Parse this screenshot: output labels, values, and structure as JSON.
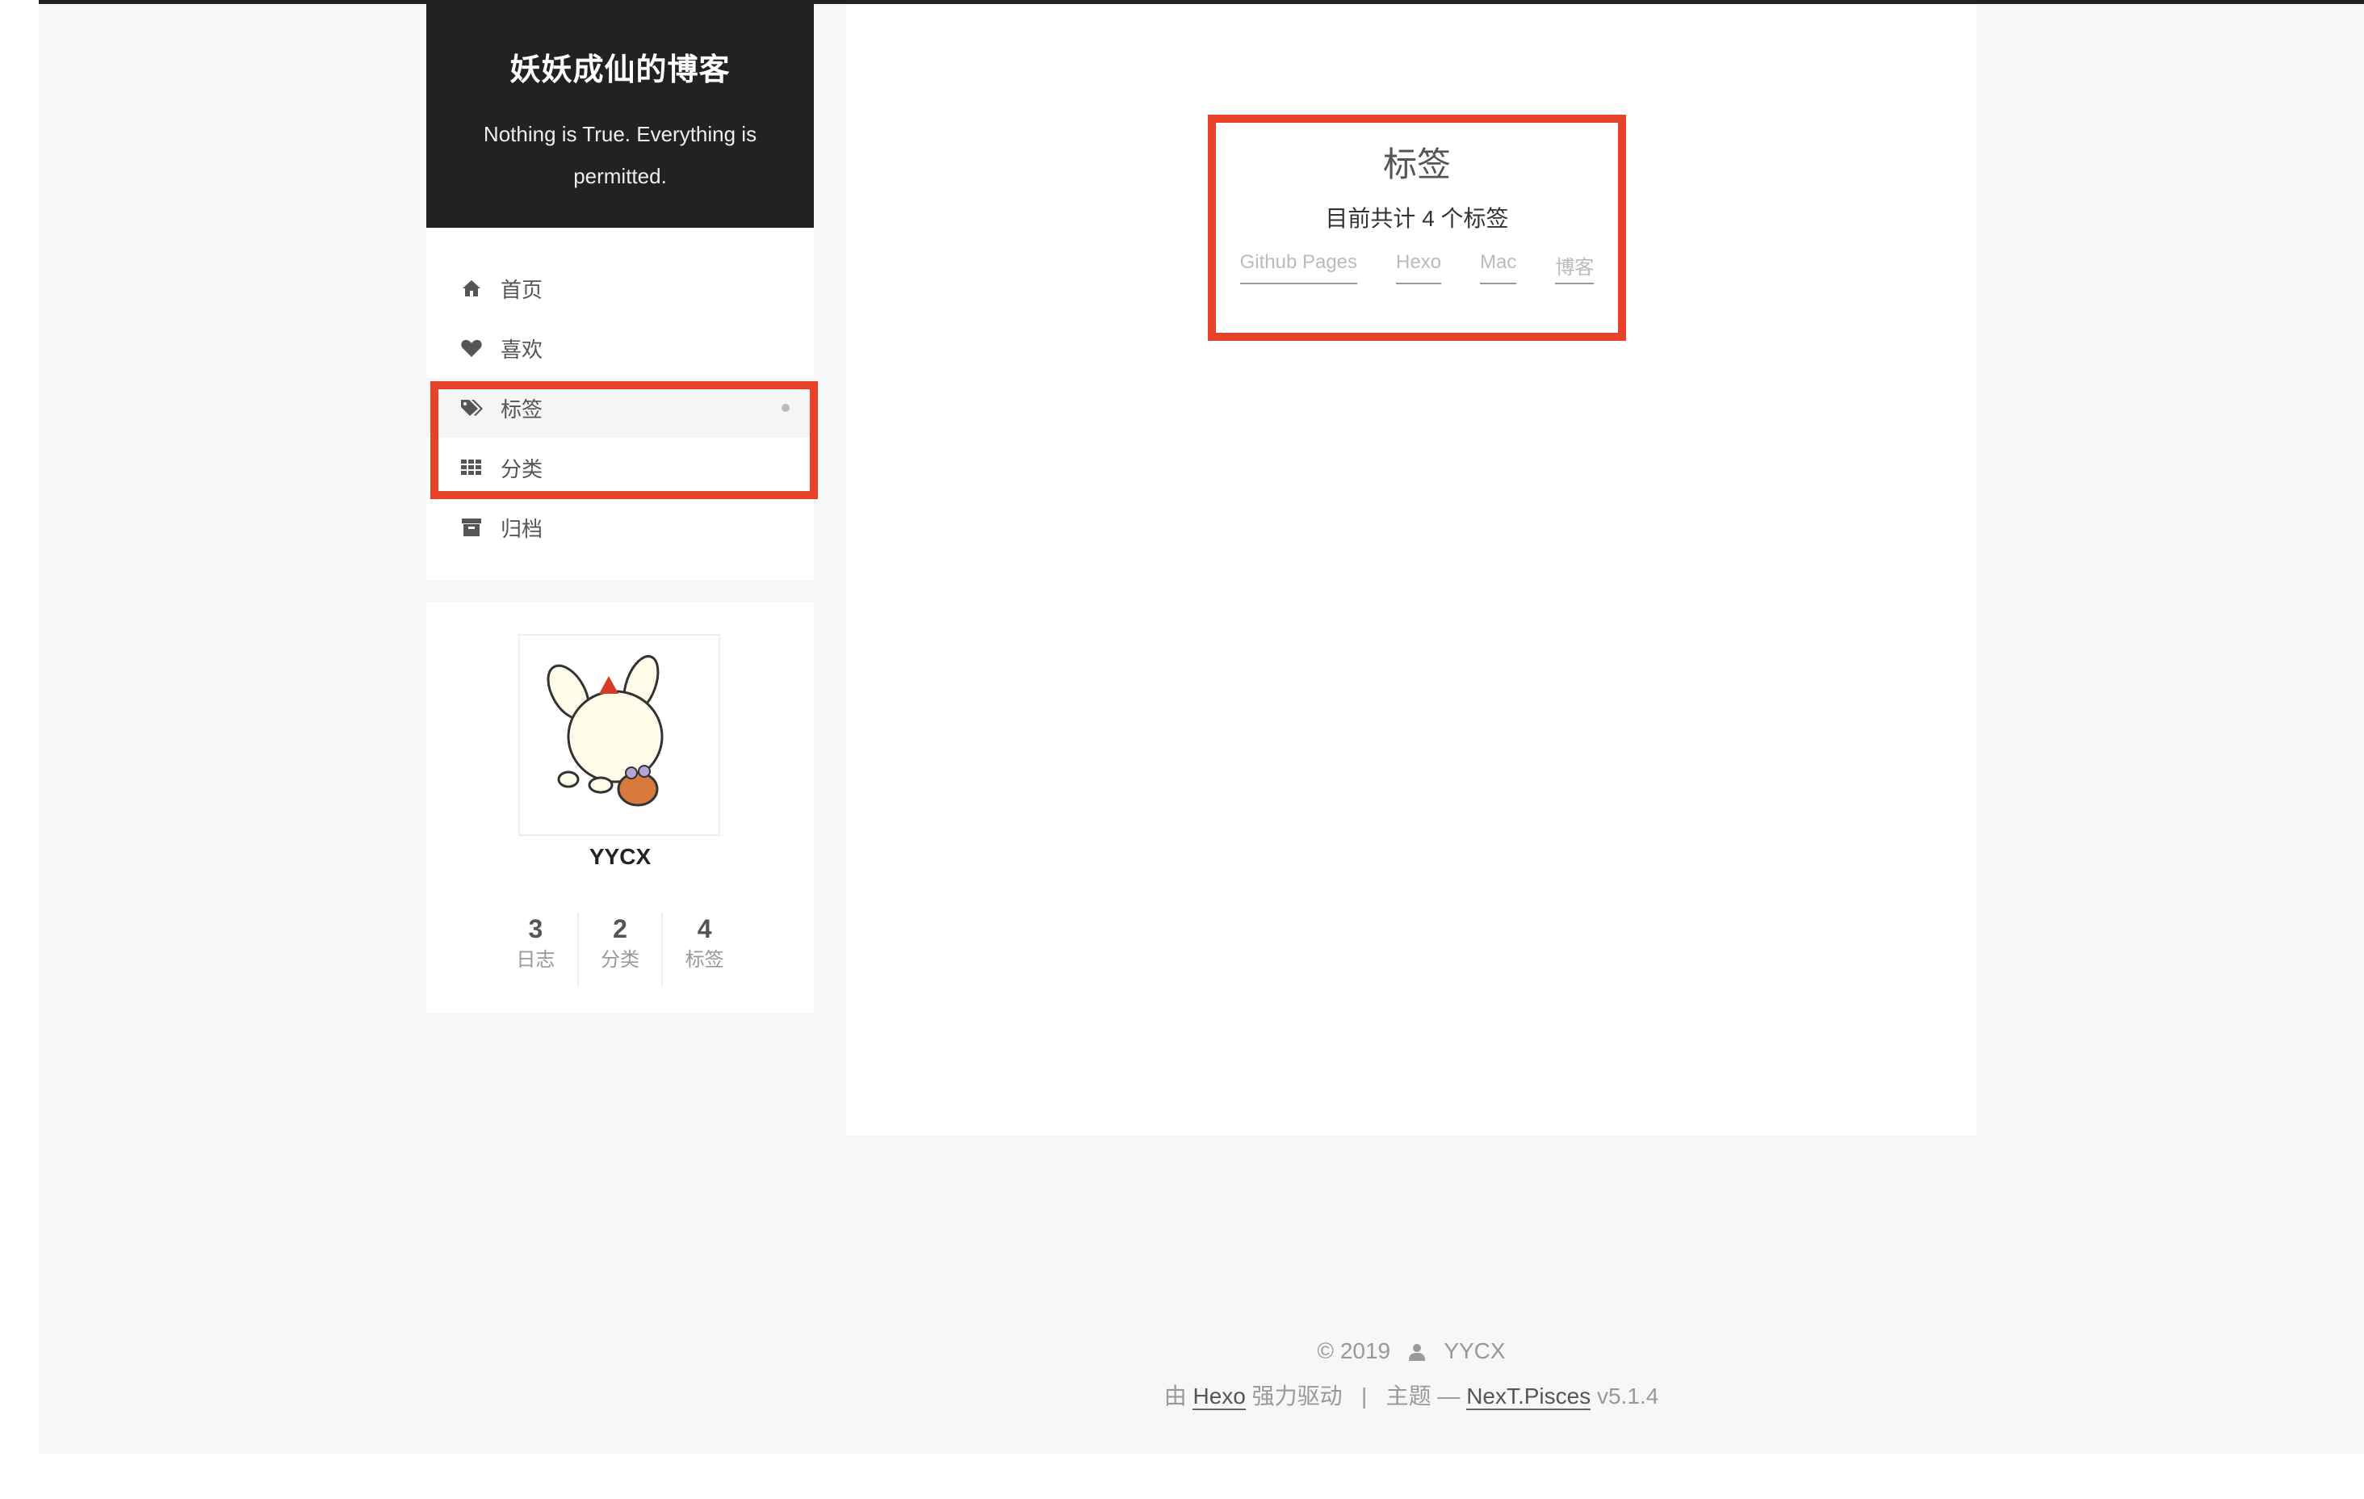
{
  "site": {
    "title": "妖妖成仙的博客",
    "subtitle": "Nothing is True. Everything is permitted."
  },
  "menu": {
    "items": [
      {
        "label": "首页",
        "icon": "home-icon"
      },
      {
        "label": "喜欢",
        "icon": "heart-icon"
      },
      {
        "label": "标签",
        "icon": "tags-icon",
        "active": true
      },
      {
        "label": "分类",
        "icon": "grid-icon"
      },
      {
        "label": "归档",
        "icon": "archive-icon"
      }
    ]
  },
  "author": {
    "name": "YYCX",
    "stats": [
      {
        "count": "3",
        "label": "日志"
      },
      {
        "count": "2",
        "label": "分类"
      },
      {
        "count": "4",
        "label": "标签"
      }
    ]
  },
  "main": {
    "title": "标签",
    "summary": "目前共计 4 个标签",
    "tags": [
      "Github Pages",
      "Hexo",
      "Mac",
      "博客"
    ]
  },
  "footer": {
    "copyright": "© 2019",
    "author": "YYCX",
    "powered_prefix": "由",
    "powered_link": "Hexo",
    "powered_suffix": "强力驱动",
    "separator": "|",
    "theme_prefix": "主题 —",
    "theme_link": "NexT.Pisces",
    "theme_version": "v5.1.4"
  },
  "colors": {
    "highlight": "#e8412a",
    "sidebar_header": "#222222",
    "page_background": "#f5f7f9"
  }
}
